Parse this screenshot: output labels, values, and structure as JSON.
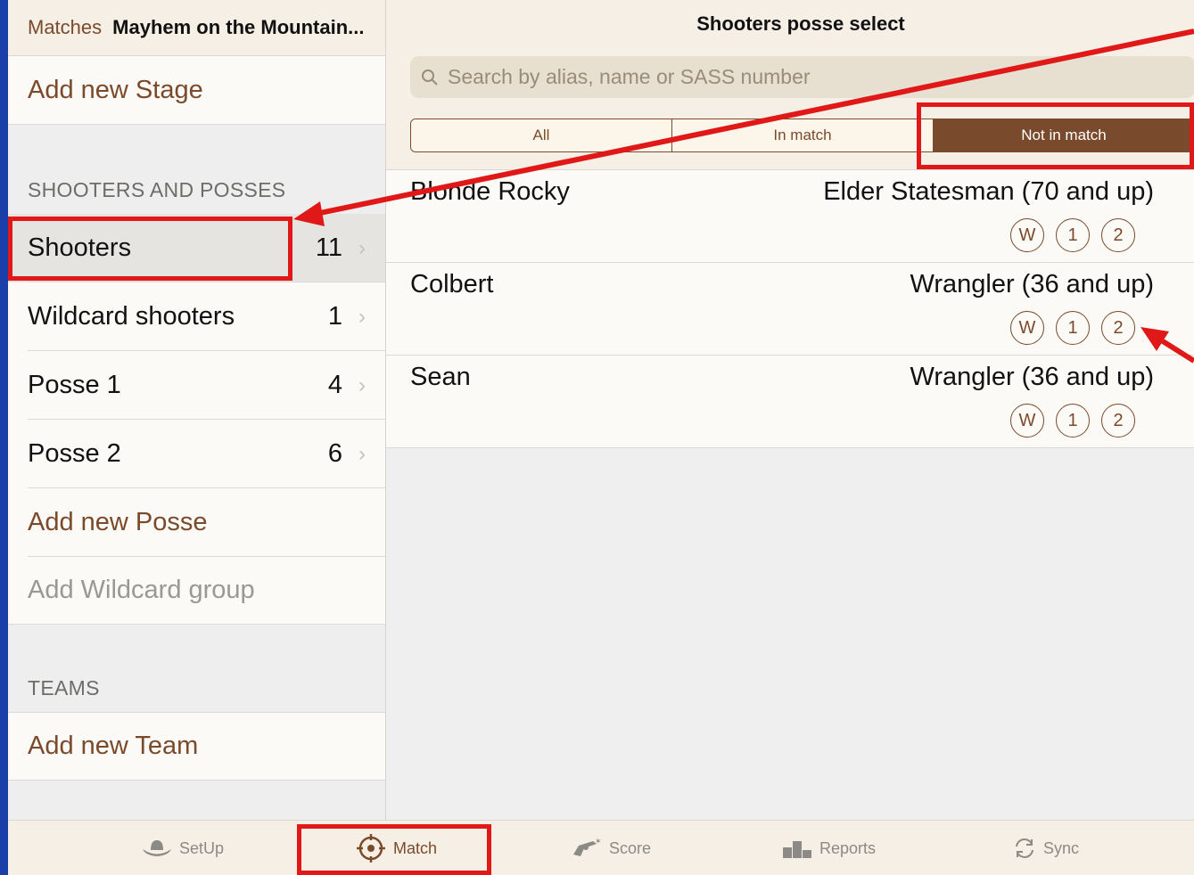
{
  "left_panel": {
    "back_label": "Matches",
    "match_title": "Mayhem on the Mountain...",
    "add_stage": "Add new Stage",
    "section_shooters": "SHOOTERS AND POSSES",
    "rows": [
      {
        "label": "Shooters",
        "count": "11"
      },
      {
        "label": "Wildcard shooters",
        "count": "1"
      },
      {
        "label": "Posse 1",
        "count": "4"
      },
      {
        "label": "Posse 2",
        "count": "6"
      }
    ],
    "add_posse": "Add new Posse",
    "add_wildcard": "Add Wildcard group",
    "section_teams": "TEAMS",
    "add_team": "Add new Team"
  },
  "right_panel": {
    "title": "Shooters posse select",
    "search_placeholder": "Search by alias, name or SASS number",
    "segments": [
      "All",
      "In match",
      "Not in match"
    ],
    "selected_segment": "Not in match",
    "shooters": [
      {
        "name": "Blonde Rocky",
        "category": "Elder Statesman (70 and up)",
        "chips": [
          "W",
          "1",
          "2"
        ]
      },
      {
        "name": "Colbert",
        "category": "Wrangler (36 and up)",
        "chips": [
          "W",
          "1",
          "2"
        ]
      },
      {
        "name": "Sean",
        "category": "Wrangler (36 and up)",
        "chips": [
          "W",
          "1",
          "2"
        ]
      }
    ]
  },
  "tabbar": {
    "tabs": [
      {
        "label": "SetUp",
        "icon": "cowboy-hat-icon"
      },
      {
        "label": "Match",
        "icon": "target-icon"
      },
      {
        "label": "Score",
        "icon": "revolver-icon"
      },
      {
        "label": "Reports",
        "icon": "podium-icon"
      },
      {
        "label": "Sync",
        "icon": "sync-icon"
      }
    ],
    "active": "Match"
  },
  "colors": {
    "accent": "#7b4a2b",
    "annotation": "#e01818",
    "background": "#1a3fa8"
  }
}
